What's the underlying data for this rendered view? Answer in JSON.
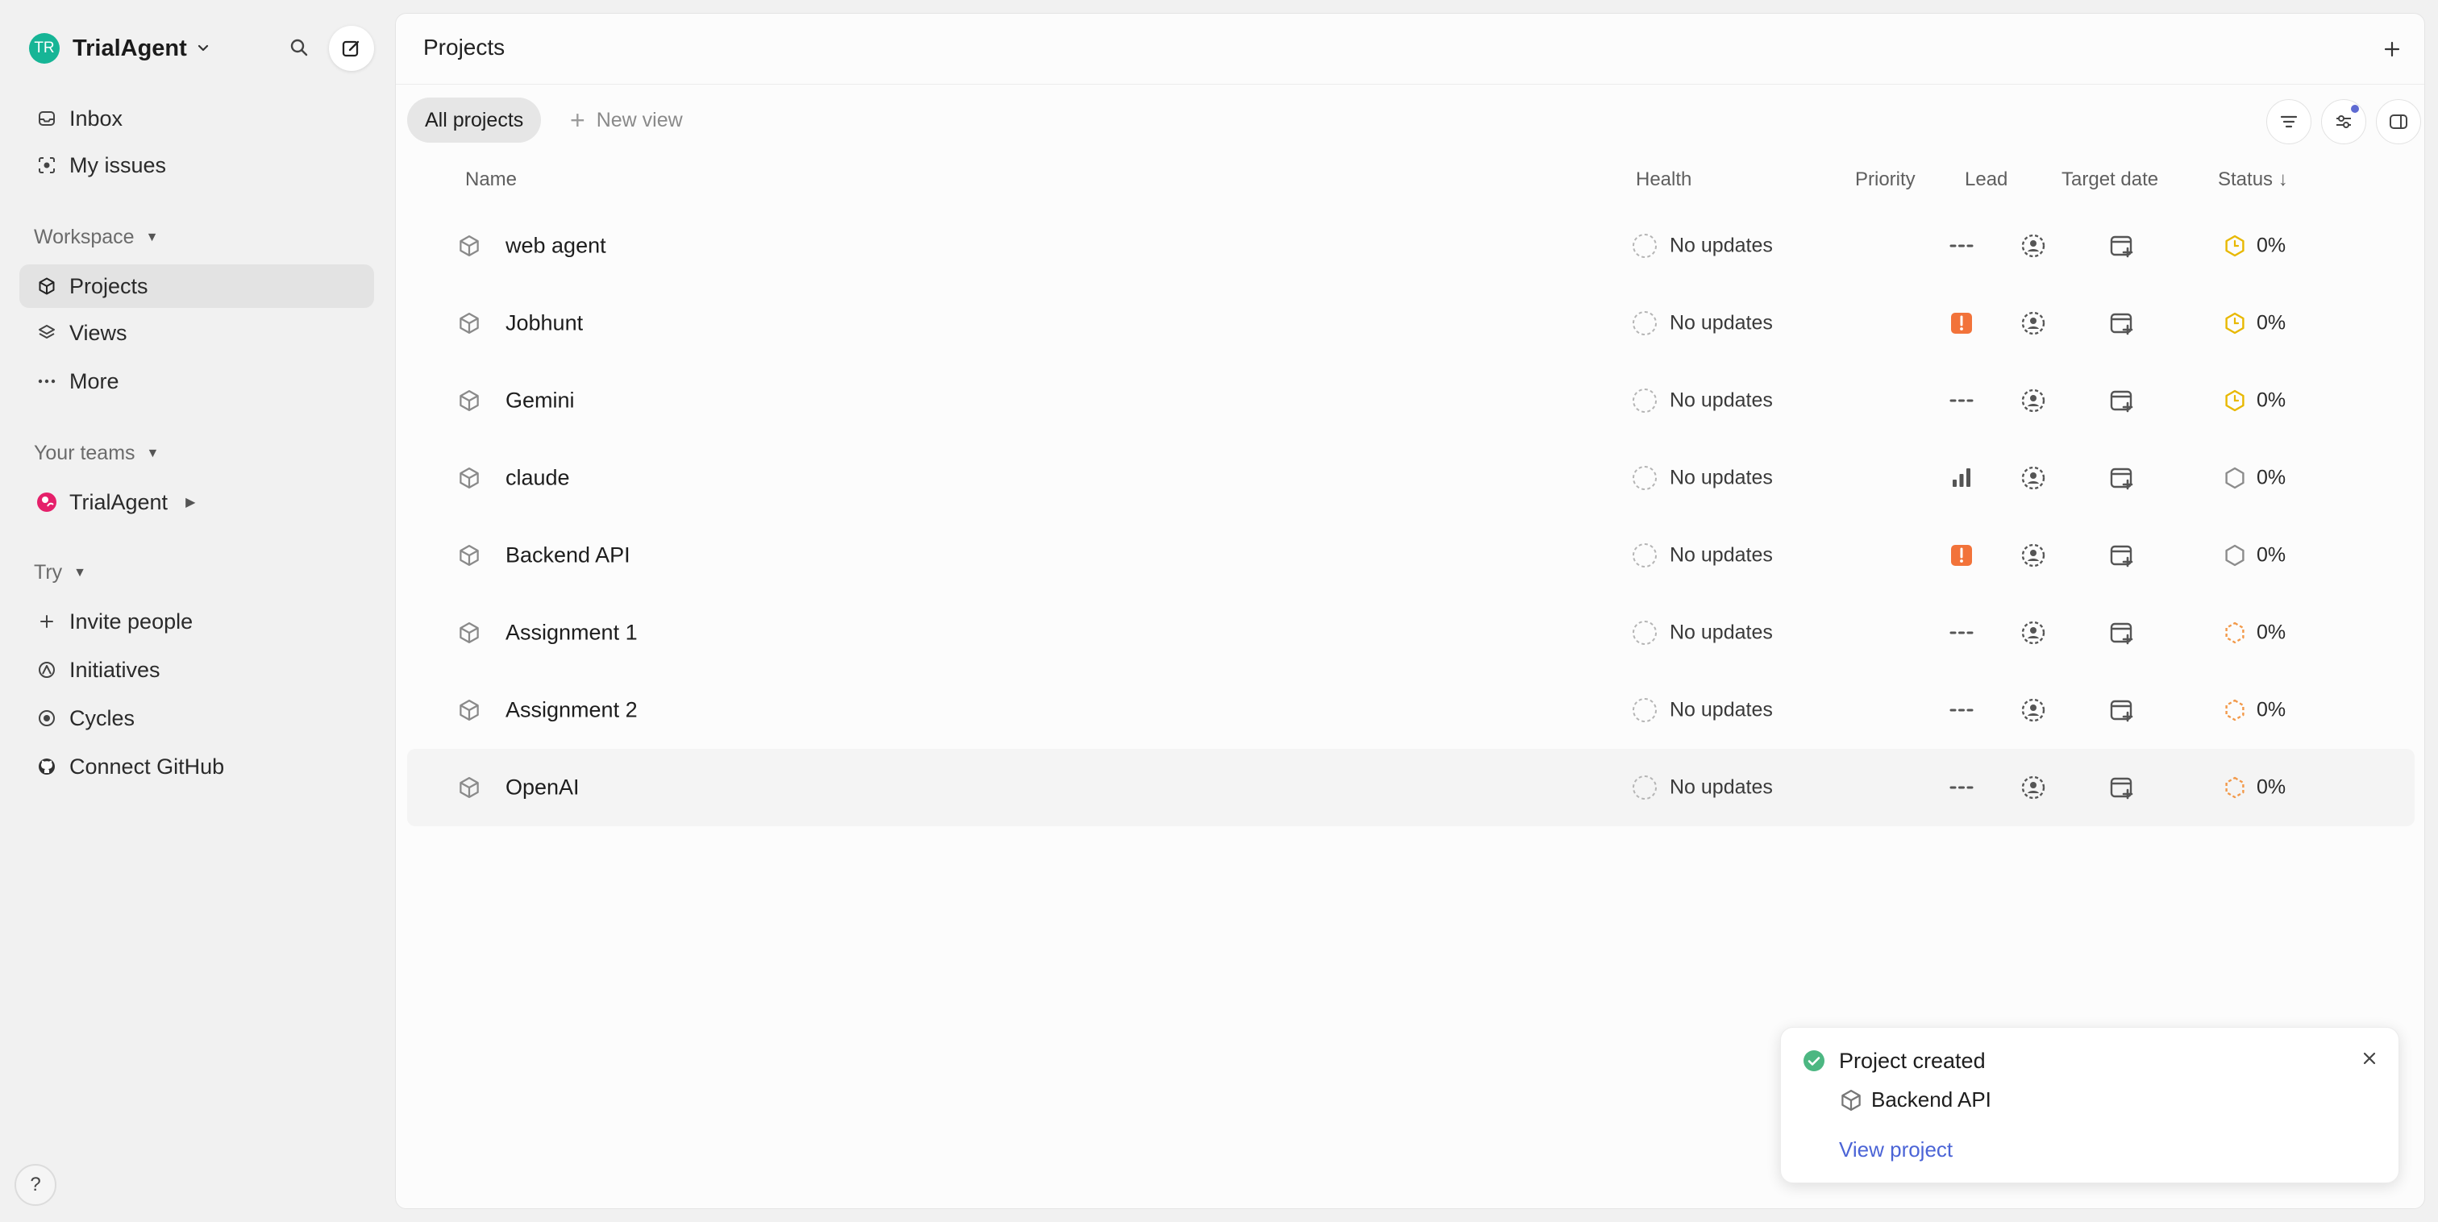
{
  "workspace": {
    "initials": "TR",
    "name": "TrialAgent"
  },
  "sidebar": {
    "nav": [
      {
        "label": "Inbox",
        "icon": "inbox-icon"
      },
      {
        "label": "My issues",
        "icon": "target-icon"
      }
    ],
    "workspace_label": "Workspace",
    "workspace_items": [
      {
        "label": "Projects",
        "icon": "cube-icon",
        "active": true
      },
      {
        "label": "Views",
        "icon": "layers-icon"
      },
      {
        "label": "More",
        "icon": "ellipsis-icon"
      }
    ],
    "teams_label": "Your teams",
    "team": {
      "label": "TrialAgent"
    },
    "try_label": "Try",
    "try_items": [
      {
        "label": "Invite people",
        "icon": "plus-icon"
      },
      {
        "label": "Initiatives",
        "icon": "initiatives-icon"
      },
      {
        "label": "Cycles",
        "icon": "cycle-icon"
      },
      {
        "label": "Connect GitHub",
        "icon": "github-icon"
      }
    ],
    "help": "?"
  },
  "main": {
    "title": "Projects",
    "views": {
      "active": "All projects",
      "new": "New view"
    },
    "columns": {
      "name": "Name",
      "health": "Health",
      "priority": "Priority",
      "lead": "Lead",
      "target_date": "Target date",
      "status": "Status ↓"
    },
    "projects": [
      {
        "name": "web agent",
        "health": "No updates",
        "priority": "none",
        "status": "0%",
        "status_kind": "in-progress"
      },
      {
        "name": "Jobhunt",
        "health": "No updates",
        "priority": "urgent",
        "status": "0%",
        "status_kind": "in-progress"
      },
      {
        "name": "Gemini",
        "health": "No updates",
        "priority": "none",
        "status": "0%",
        "status_kind": "in-progress"
      },
      {
        "name": "claude",
        "health": "No updates",
        "priority": "medium",
        "status": "0%",
        "status_kind": "planned"
      },
      {
        "name": "Backend API",
        "health": "No updates",
        "priority": "urgent",
        "status": "0%",
        "status_kind": "planned"
      },
      {
        "name": "Assignment 1",
        "health": "No updates",
        "priority": "none",
        "status": "0%",
        "status_kind": "backlog"
      },
      {
        "name": "Assignment 2",
        "health": "No updates",
        "priority": "none",
        "status": "0%",
        "status_kind": "backlog"
      },
      {
        "name": "OpenAI",
        "health": "No updates",
        "priority": "none",
        "status": "0%",
        "status_kind": "backlog"
      }
    ]
  },
  "toast": {
    "title": "Project created",
    "project": "Backend API",
    "link": "View project"
  },
  "colors": {
    "accent": "#5e6ad2",
    "avatar": "#16b596",
    "urgent": "#f2733a",
    "in_progress": "#f2c94c",
    "backlog": "#f2994a",
    "success": "#4cb782",
    "link": "#4b64d6"
  }
}
